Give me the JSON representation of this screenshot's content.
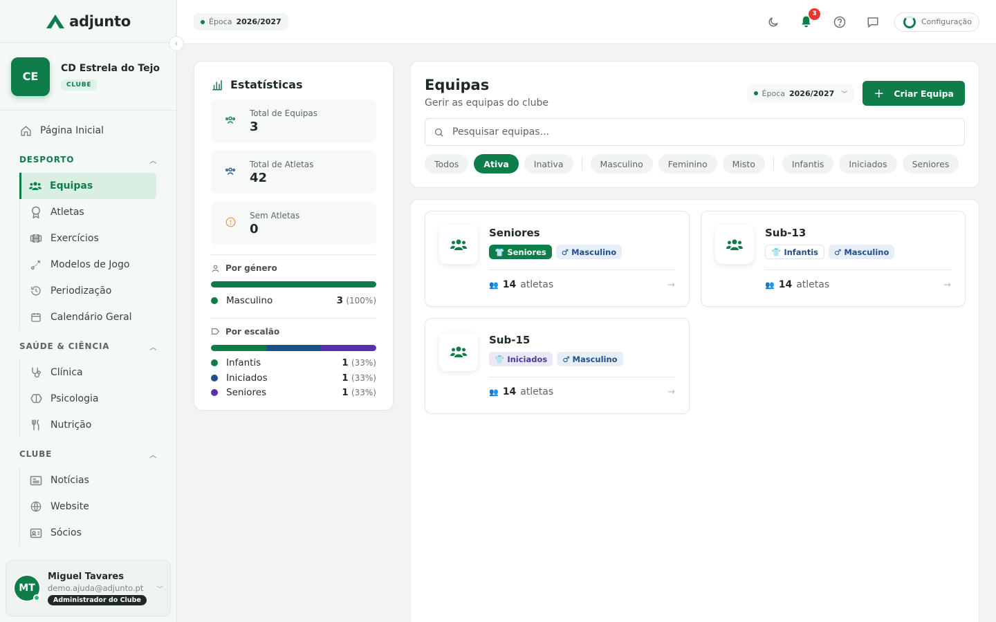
{
  "app": {
    "name": "adjunto",
    "accent": "#0e7d4a"
  },
  "club": {
    "initials": "CE",
    "name": "CD Estrela do Tejo",
    "badge": "CLUBE"
  },
  "nav": {
    "home": "Página Inicial",
    "sections": [
      {
        "title": "DESPORTO",
        "color": "#0e7d4a",
        "items": [
          "Equipas",
          "Atletas",
          "Exercícios",
          "Modelos de Jogo",
          "Periodização",
          "Calendário Geral"
        ]
      },
      {
        "title": "SAÚDE & CIÊNCIA",
        "color": "#5d6762",
        "items": [
          "Clínica",
          "Psicologia",
          "Nutrição"
        ]
      },
      {
        "title": "CLUBE",
        "color": "#5d6762",
        "items": [
          "Notícias",
          "Website",
          "Sócios"
        ]
      }
    ]
  },
  "user": {
    "initials": "MT",
    "name": "Miguel Tavares",
    "email": "demo.ajuda@adjunto.pt",
    "role": "Administrador do Clube"
  },
  "topbar": {
    "season_label": "Época",
    "season_value": "2026/2027",
    "notifications": "3",
    "config": "Configuração"
  },
  "stats": {
    "title": "Estatísticas",
    "cards": [
      {
        "label": "Total de Equipas",
        "value": "3"
      },
      {
        "label": "Total de Atletas",
        "value": "42"
      },
      {
        "label": "Sem Atletas",
        "value": "0"
      }
    ],
    "gender": {
      "title": "Por género",
      "items": [
        {
          "label": "Masculino",
          "count": "3",
          "pct": "(100%)",
          "share": 1.0,
          "color": "#0e7d4a"
        }
      ]
    },
    "level": {
      "title": "Por escalão",
      "items": [
        {
          "label": "Infantis",
          "count": "1",
          "pct": "(33%)",
          "share": 0.333,
          "color": "#0e7d4a"
        },
        {
          "label": "Iniciados",
          "count": "1",
          "pct": "(33%)",
          "share": 0.333,
          "color": "#1f4e8c"
        },
        {
          "label": "Seniores",
          "count": "1",
          "pct": "(33%)",
          "share": 0.334,
          "color": "#5b2fb0"
        }
      ]
    }
  },
  "teams": {
    "title": "Equipas",
    "subtitle": "Gerir as equipas do clube",
    "season_label": "Época",
    "season_value": "2026/2027",
    "create": "Criar Equipa",
    "search_placeholder": "Pesquisar equipas...",
    "filters": [
      "Todos",
      "Ativa",
      "Inativa",
      "Masculino",
      "Feminino",
      "Misto",
      "Infantis",
      "Iniciados",
      "Seniores"
    ],
    "active_filter": "Ativa",
    "list": [
      {
        "name": "Seniores",
        "level": "Seniores",
        "gender": "Masculino",
        "athletes": "14",
        "athletes_label": "atletas"
      },
      {
        "name": "Sub-13",
        "level": "Infantis",
        "gender": "Masculino",
        "athletes": "14",
        "athletes_label": "atletas"
      },
      {
        "name": "Sub-15",
        "level": "Iniciados",
        "gender": "Masculino",
        "athletes": "14",
        "athletes_label": "atletas"
      }
    ]
  }
}
